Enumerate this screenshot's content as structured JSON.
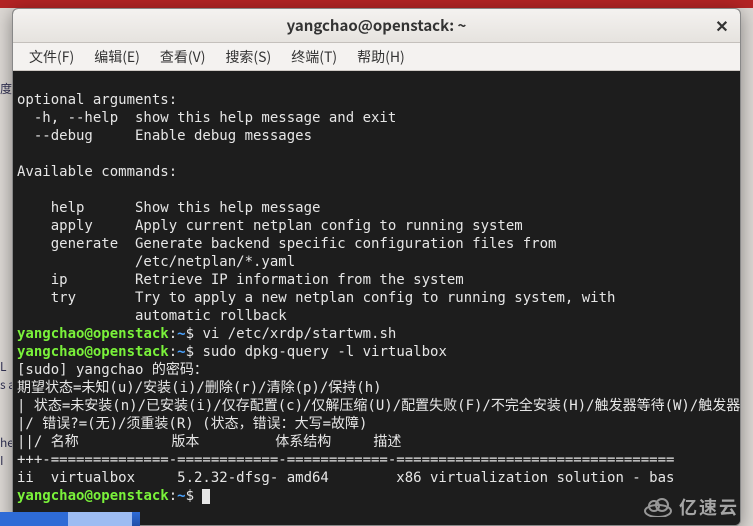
{
  "window": {
    "title": "yangchao@openstack: ~",
    "close_glyph": "✕"
  },
  "menu": {
    "file": "文件(F)",
    "edit": "编辑(E)",
    "view": "查看(V)",
    "search": "搜索(S)",
    "terminal": "终端(T)",
    "help": "帮助(H)"
  },
  "prompt": {
    "user": "yangchao",
    "at": "@",
    "host": "openstack",
    "colon": ":",
    "path": "~",
    "dollar": "$ "
  },
  "cmds": {
    "c1": "vi /etc/xrdp/startwm.sh",
    "c2": "sudo dpkg-query -l virtualbox",
    "c3": ""
  },
  "out": {
    "l01": "optional arguments:",
    "l02": "  -h, --help  show this help message and exit",
    "l03": "  --debug     Enable debug messages",
    "l04": "",
    "l05": "Available commands:",
    "l06": "",
    "l07": "    help      Show this help message",
    "l08": "    apply     Apply current netplan config to running system",
    "l09": "    generate  Generate backend specific configuration files from",
    "l10": "              /etc/netplan/*.yaml",
    "l11": "    ip        Retrieve IP information from the system",
    "l12": "    try       Try to apply a new netplan config to running system, with",
    "l13": "              automatic rollback",
    "s01": "[sudo] yangchao 的密码：",
    "s02": "期望状态=未知(u)/安装(i)/删除(r)/清除(p)/保持(h)",
    "s03": "| 状态=未安装(n)/已安装(i)/仅存配置(c)/仅解压缩(U)/配置失败(F)/不完全安装(H)/触发器等待(W)/触发器未决(T)",
    "s04": "|/ 错误?=(无)/须重装(R) (状态，错误：大写=故障)",
    "s05": "||/ 名称           版本         体系结构     描述",
    "s06": "+++-==============-============-============-=================================",
    "s07": "ii  virtualbox     5.2.32-dfsg- amd64        x86 virtualization solution - bas"
  },
  "watermark": "亿速云",
  "side": {
    "a": "度",
    "b": "L",
    "c": "s a",
    "d": "he",
    "e": "I"
  }
}
